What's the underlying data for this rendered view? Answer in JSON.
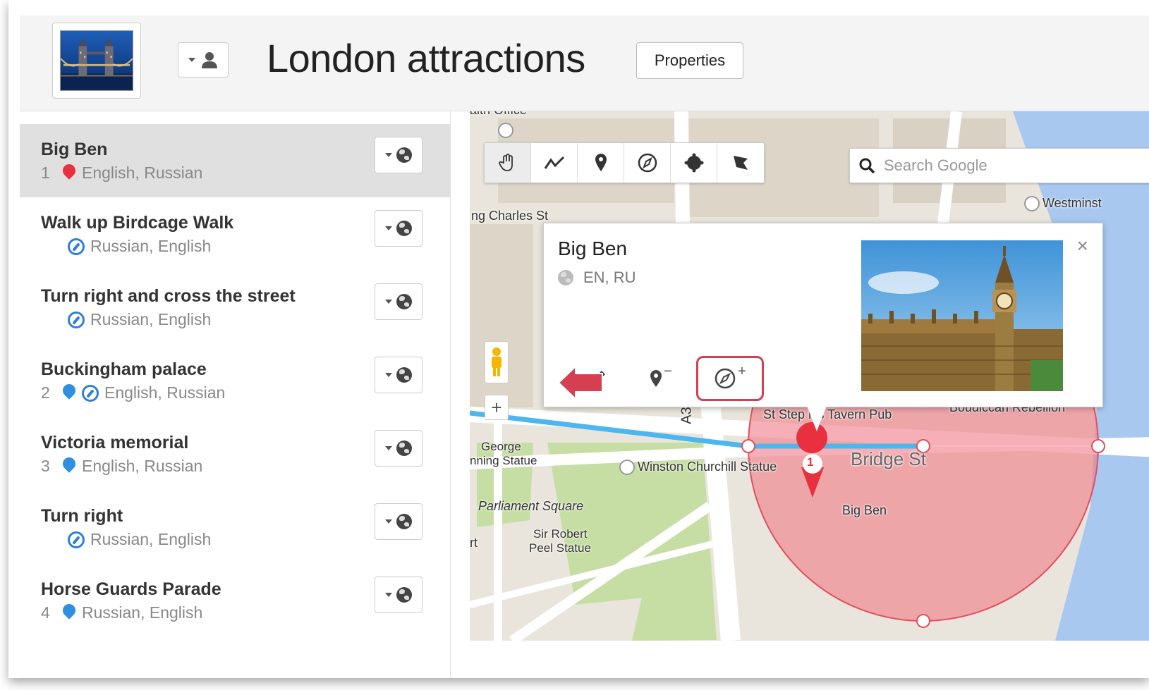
{
  "header": {
    "title": "London attractions",
    "properties_label": "Properties"
  },
  "sidebar": {
    "items": [
      {
        "name": "Big Ben",
        "number": "1",
        "languages": "English, Russian",
        "marker": "red-pin",
        "active": true
      },
      {
        "name": "Walk up Birdcage Walk",
        "number": "",
        "languages": "Russian, English",
        "marker": "compass"
      },
      {
        "name": "Turn right and cross the street",
        "number": "",
        "languages": "Russian, English",
        "marker": "compass"
      },
      {
        "name": "Buckingham palace",
        "number": "2",
        "languages": "English, Russian",
        "marker": "blue-pin+compass"
      },
      {
        "name": "Victoria memorial",
        "number": "3",
        "languages": "English, Russian",
        "marker": "blue-pin"
      },
      {
        "name": "Turn right",
        "number": "",
        "languages": "Russian, English",
        "marker": "compass"
      },
      {
        "name": "Horse Guards Parade",
        "number": "4",
        "languages": "Russian, English",
        "marker": "blue-pin"
      }
    ]
  },
  "map": {
    "toolbar": [
      "hand-icon",
      "line-icon",
      "pin-icon",
      "compass-icon",
      "circle-icon",
      "polygon-icon"
    ],
    "search_placeholder": "Search Google",
    "zoom_in": "+",
    "labels": {
      "westminster": "Westminst",
      "king_charles": "ng Charles St",
      "tavern": "St Step  n's Tavern Pub",
      "boudiccan": "Boudiccan Rebellion",
      "george": "George",
      "canning_statue": "nning Statue",
      "winston": "Winston Churchill Statue",
      "bridge_st": "Bridge St",
      "big_ben": "Big Ben",
      "parliament_sq": "Parliament Square",
      "sir_robert": "Sir Robert",
      "peel_statue": "Peel Statue",
      "a3": "A3",
      "health_office": "alth Office",
      "rt": "rt",
      "marker_num": "1"
    },
    "popup": {
      "title": "Big Ben",
      "languages": "EN, RU",
      "close": "×",
      "remove_sup": "−",
      "add_sup": "+"
    },
    "colors": {
      "circle_fill": "#f07a86",
      "route": "#4cb6ee",
      "highlight": "#d63f52"
    }
  }
}
